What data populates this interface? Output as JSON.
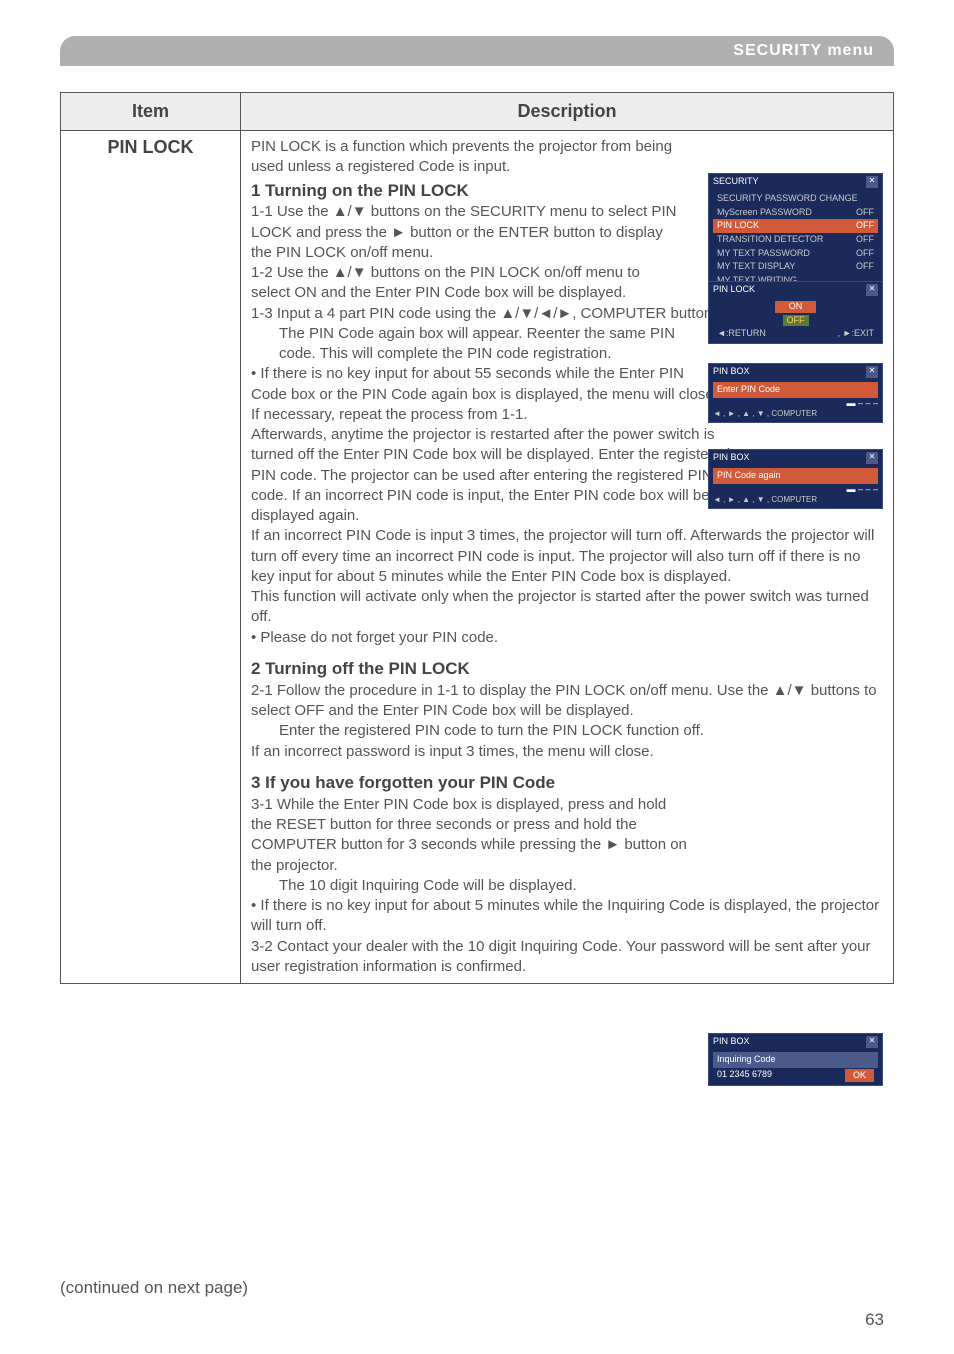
{
  "header": {
    "title": "SECURITY menu"
  },
  "table": {
    "header_item": "Item",
    "header_desc": "Description",
    "item_name": "PIN LOCK"
  },
  "desc": {
    "intro": "PIN LOCK is a function which prevents the projector from being used unless a registered Code is input.",
    "s1_title": "1 Turning on the PIN LOCK",
    "s1_1": "1-1 Use the ▲/▼ buttons on the SECURITY menu to select PIN LOCK and press the ► button or the ENTER button to display the PIN LOCK on/off menu.",
    "s1_2": "1-2 Use the ▲/▼ buttons on the PIN LOCK on/off menu to select ON and the Enter PIN Code box will be displayed.",
    "s1_3": "1-3  Input a 4 part PIN code using the ▲/▼/◄/►, COMPUTER button.",
    "s1_p1": "The PIN Code again box will appear. Reenter the same PIN code. This will complete the PIN code registration.",
    "s1_bullet1_a": "• If there is no key input for about 55 seconds while the Enter PIN Code box or the PIN Code again box is displayed, the menu will close. If necessary, repeat the process from 1-1.",
    "s1_bullet1_b": "Afterwards, anytime the projector is restarted after the power switch is turned off the Enter PIN Code box will be displayed. Enter the registered PIN code. The projector can be used after entering the registered PIN code. If an incorrect PIN code is input, the Enter PIN code box will be displayed again.",
    "s1_p2": "If an incorrect PIN Code is input 3 times, the projector will turn off. Afterwards the projector will turn off every time an incorrect PIN code is input. The projector will also turn off if there is no key input for about 5 minutes while the Enter PIN Code box is displayed.",
    "s1_p3": "This function will activate only when the projector is started after the power switch was turned off.",
    "s1_bullet2": "• Please do not forget your PIN code.",
    "s2_title": "2 Turning off the PIN LOCK",
    "s2_1a": "2-1 Follow the procedure in 1-1 to display the PIN LOCK on/off menu. Use the ▲/▼ buttons to select OFF and the Enter PIN Code box will be displayed.",
    "s2_1b": "Enter the registered PIN code to turn the PIN LOCK function off.",
    "s2_p1": "If an incorrect password is input 3 times, the menu will close.",
    "s3_title": "3 If you have forgotten your PIN Code",
    "s3_1a": "3-1 While the Enter PIN Code box is displayed, press and hold the RESET button for three seconds or press and hold the COMPUTER button for 3 seconds while pressing the ► button on the projector.",
    "s3_1b": "The 10 digit Inquiring Code will be displayed.",
    "s3_bullet": "• If there is no key input for about 5 minutes while the Inquiring Code is displayed, the projector will turn off.",
    "s3_2": "3-2 Contact your dealer with the 10 digit Inquiring Code. Your password will be sent after your user registration information is confirmed."
  },
  "osd": {
    "security": {
      "title": "SECURITY",
      "rows": [
        {
          "label": "SECURITY PASSWORD CHANGE",
          "val": ""
        },
        {
          "label": "MyScreen PASSWORD",
          "val": "OFF"
        },
        {
          "label": "PIN LOCK",
          "val": "OFF",
          "hl": true
        },
        {
          "label": "TRANSITION DETECTOR",
          "val": "OFF"
        },
        {
          "label": "MY TEXT PASSWORD",
          "val": "OFF"
        },
        {
          "label": "MY TEXT DISPLAY",
          "val": "OFF"
        },
        {
          "label": "MY TEXT WRITING",
          "val": ""
        }
      ],
      "footer": "◄:RETURN"
    },
    "pinlock": {
      "title": "PIN LOCK",
      "on": "ON",
      "off": "OFF",
      "footer_l": "◄:RETURN",
      "footer_r": ", ►:EXIT"
    },
    "enter": {
      "title": "PIN BOX",
      "label": "Enter PIN Code",
      "hint": "◄ , ► , ▲ , ▼ , COMPUTER"
    },
    "again": {
      "title": "PIN BOX",
      "label": "PIN Code again",
      "hint": "◄ , ► , ▲ , ▼ , COMPUTER"
    },
    "inquiring": {
      "title": "PIN BOX",
      "label": "Inquiring Code",
      "code": "01 2345 6789",
      "ok": "OK"
    }
  },
  "continued": "(continued on next page)",
  "page": "63"
}
